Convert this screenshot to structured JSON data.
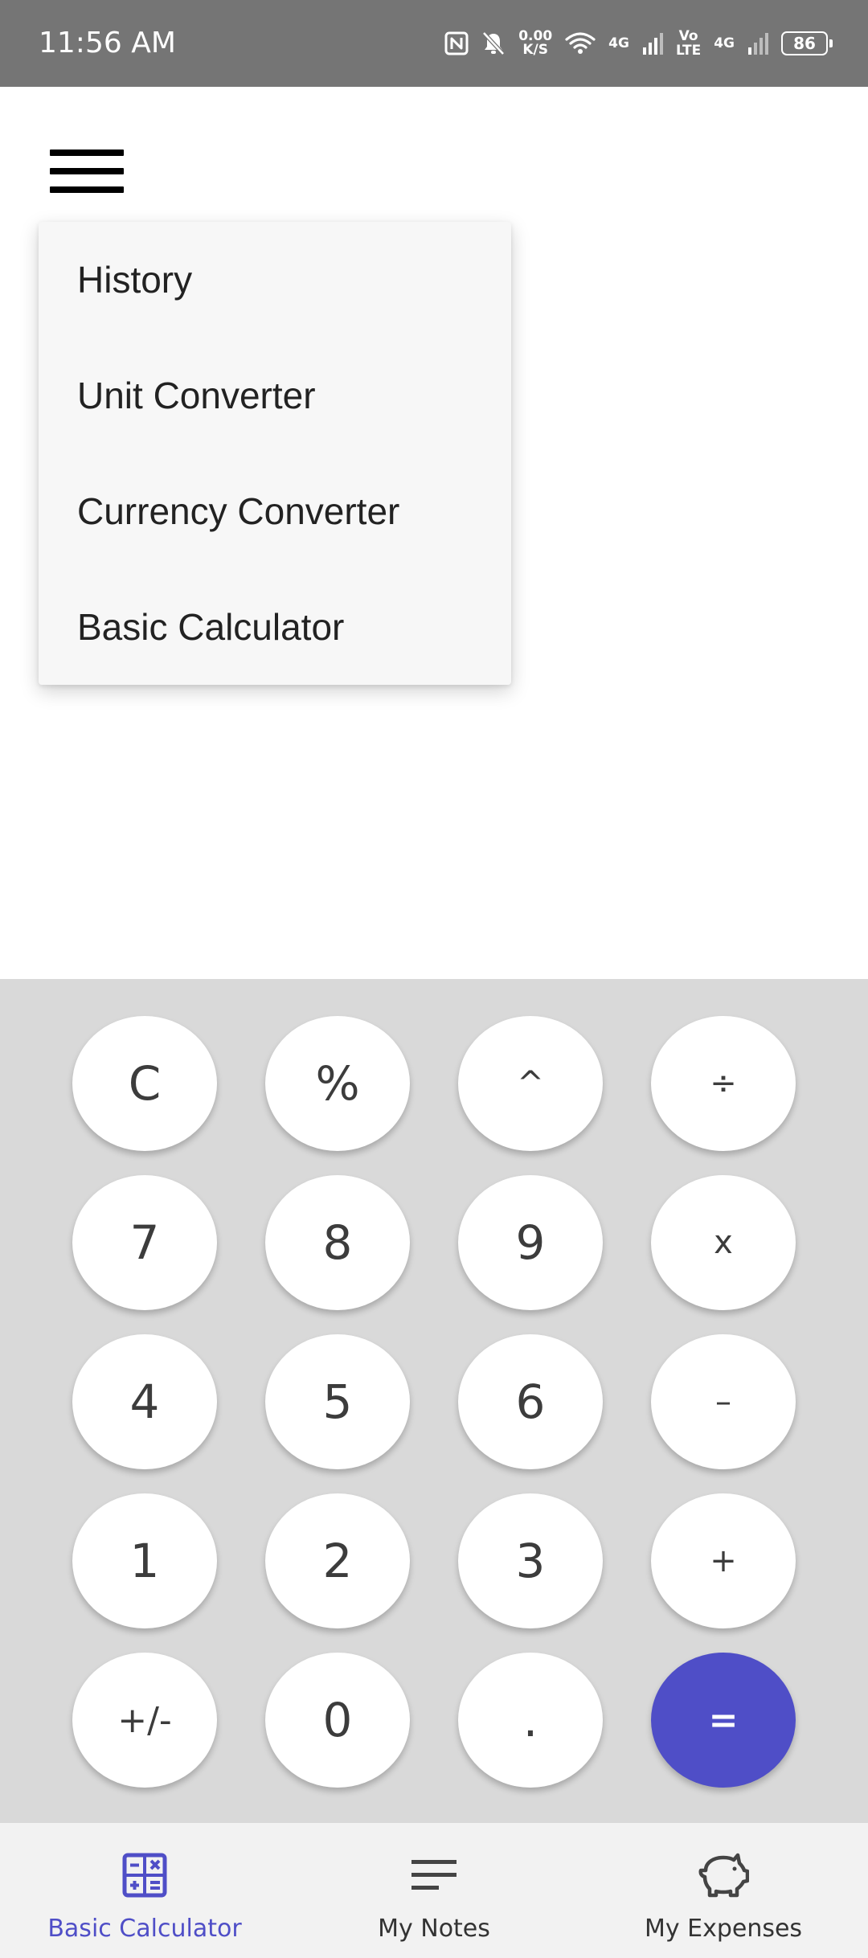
{
  "status_bar": {
    "time": "11:56 AM",
    "net_speed_value": "0.00",
    "net_speed_unit": "K/S",
    "sim1_tag": "4G",
    "volte_top": "Vo",
    "volte_bottom": "LTE",
    "sim2_tag": "4G",
    "battery_level": "86",
    "icons": [
      "nfc-icon",
      "mute-bell-icon",
      "wifi-icon",
      "signal-icon",
      "signal-icon",
      "battery-icon"
    ]
  },
  "menu": {
    "icon": "hamburger-icon",
    "items": [
      {
        "label": "History"
      },
      {
        "label": "Unit Converter"
      },
      {
        "label": "Currency Converter"
      },
      {
        "label": "Basic Calculator"
      }
    ]
  },
  "keypad": {
    "rows": [
      [
        "C",
        "%",
        "^",
        "÷"
      ],
      [
        "7",
        "8",
        "9",
        "x"
      ],
      [
        "4",
        "5",
        "6",
        "–"
      ],
      [
        "1",
        "2",
        "3",
        "+"
      ],
      [
        "+/-",
        "0",
        ".",
        "="
      ]
    ],
    "accent_color": "#4f4ec7"
  },
  "bottom_nav": {
    "active_color": "#4f4ec7",
    "items": [
      {
        "label": "Basic Calculator",
        "icon": "calculator-icon",
        "active": true
      },
      {
        "label": "My Notes",
        "icon": "notes-icon",
        "active": false
      },
      {
        "label": "My Expenses",
        "icon": "piggy-bank-icon",
        "active": false
      }
    ]
  }
}
